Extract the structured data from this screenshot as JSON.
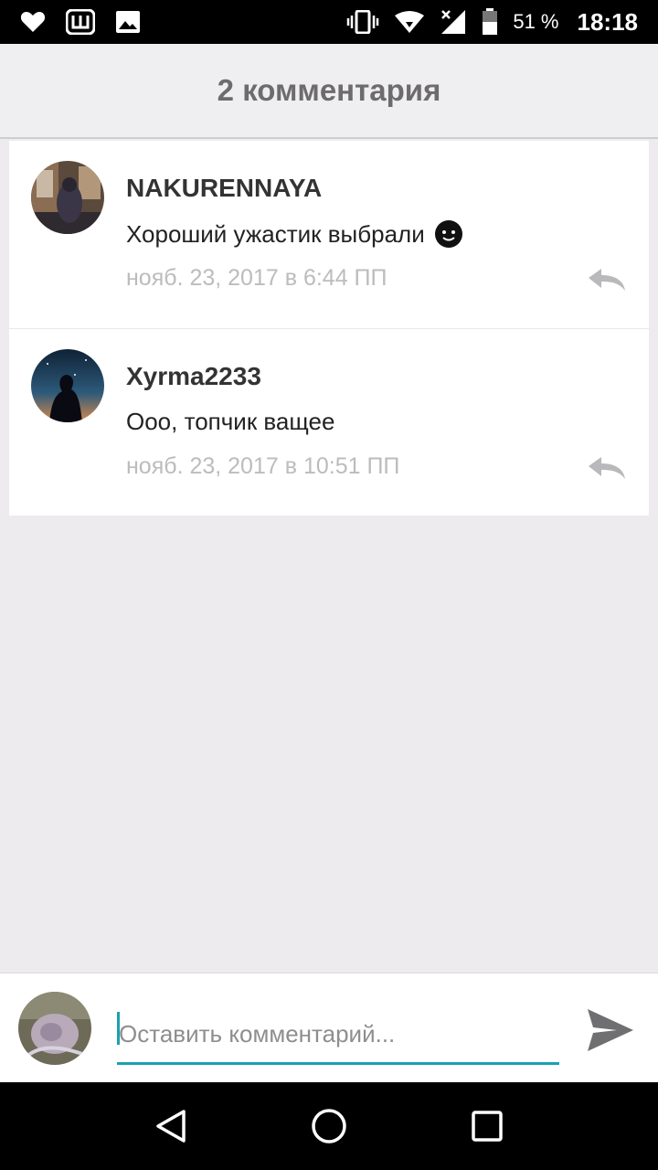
{
  "status_bar": {
    "battery_percent": "51 %",
    "time": "18:18",
    "icons": [
      "heart-icon",
      "w-app-icon",
      "image-icon",
      "vibrate-icon",
      "wifi-icon",
      "signal-icon",
      "battery-icon"
    ]
  },
  "header": {
    "title": "2 комментария"
  },
  "comments": [
    {
      "author": "NAKURENNAYA",
      "text": "Хороший ужастик выбрали",
      "time": "нояб. 23, 2017 в 6:44 ПП"
    },
    {
      "author": "Xyrma2233",
      "text": "Ооо, топчик ващее",
      "time": "нояб. 23, 2017 в 10:51 ПП"
    }
  ],
  "input": {
    "placeholder": "Оставить комментарий...",
    "value": ""
  },
  "colors": {
    "accent": "#1aa1b0",
    "background": "#edebee",
    "muted_text": "#bcbbbe"
  }
}
